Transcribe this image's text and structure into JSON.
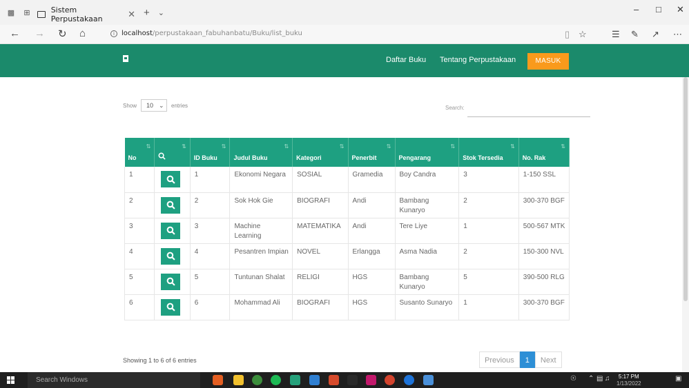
{
  "browser": {
    "tab_title": "Sistem Perpustakaan",
    "url_host": "localhost",
    "url_path": "/perpustakaan_fabuhanbatu/Buku/list_buku"
  },
  "navbar": {
    "links": [
      "Daftar Buku",
      "Tentang Perpustakaan"
    ],
    "login_label": "MASUK",
    "color": "#1b8a6b",
    "login_color": "#f99a1c"
  },
  "controls": {
    "show_label": "Show",
    "entries_value": "10",
    "entries_label": "entries",
    "search_label": "Search:"
  },
  "table": {
    "headers": [
      "No",
      "",
      "ID Buku",
      "Judul Buku",
      "Kategori",
      "Penerbit",
      "Pengarang",
      "Stok Tersedia",
      "No. Rak"
    ],
    "rows": [
      {
        "no": "1",
        "id": "1",
        "judul": "Ekonomi Negara",
        "kategori": "SOSIAL",
        "penerbit": "Gramedia",
        "pengarang": "Boy Candra",
        "stok": "3",
        "rak": "1-150 SSL"
      },
      {
        "no": "2",
        "id": "2",
        "judul": "Sok Hok Gie",
        "kategori": "BIOGRAFI",
        "penerbit": "Andi",
        "pengarang": "Bambang Kunaryo",
        "stok": "2",
        "rak": "300-370 BGF"
      },
      {
        "no": "3",
        "id": "3",
        "judul": "Machine Learning",
        "kategori": "MATEMATIKA",
        "penerbit": "Andi",
        "pengarang": "Tere Liye",
        "stok": "1",
        "rak": "500-567 MTK"
      },
      {
        "no": "4",
        "id": "4",
        "judul": "Pesantren Impian",
        "kategori": "NOVEL",
        "penerbit": "Erlangga",
        "pengarang": "Asma Nadia",
        "stok": "2",
        "rak": "150-300 NVL"
      },
      {
        "no": "5",
        "id": "5",
        "judul": "Tuntunan Shalat",
        "kategori": "RELIGI",
        "penerbit": "HGS",
        "pengarang": "Bambang Kunaryo",
        "stok": "5",
        "rak": "390-500 RLG"
      },
      {
        "no": "6",
        "id": "6",
        "judul": "Mohammad Ali",
        "kategori": "BIOGRAFI",
        "penerbit": "HGS",
        "pengarang": "Susanto Sunaryo",
        "stok": "1",
        "rak": "300-370 BGF"
      }
    ],
    "header_color": "#1ea081"
  },
  "footer": {
    "showing": "Showing 1 to 6 of 6 entries",
    "prev": "Previous",
    "page": "1",
    "next": "Next"
  },
  "taskbar": {
    "search_placeholder": "Search Windows",
    "time": "5:17 PM",
    "date": "1/13/2022"
  }
}
